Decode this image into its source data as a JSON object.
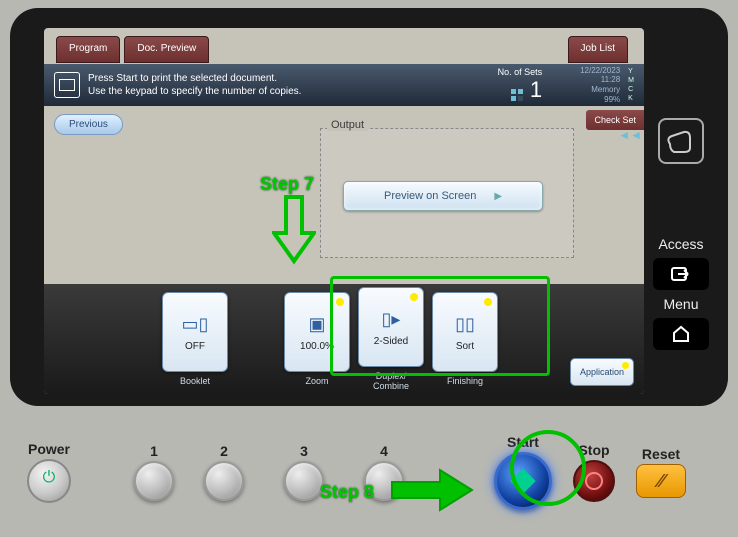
{
  "topnav": {
    "program": "Program",
    "doc_preview": "Doc. Preview",
    "job_list": "Job List"
  },
  "header": {
    "line1": "Press Start to print the selected document.",
    "line2": "Use the keypad to specify the number of copies.",
    "sets_label": "No. of Sets",
    "sets_value": "1"
  },
  "status": {
    "date": "12/22/2023",
    "time": "11:28",
    "memory_label": "Memory",
    "memory_value": "99%",
    "ind1": "Y",
    "ind2": "M",
    "ind3": "C",
    "ind4": "K"
  },
  "previous": "Previous",
  "check_settings": "Check Set",
  "output": {
    "title": "Output",
    "preview": "Preview on Screen"
  },
  "settings": {
    "booklet_val": "OFF",
    "booklet_label": "Booklet",
    "zoom_val": "100.0%",
    "zoom_label": "Zoom",
    "duplex_val": "2-Sided",
    "duplex_label": "Duplex/\nCombine",
    "finishing_val": "Sort",
    "finishing_label": "Finishing",
    "application": "Application"
  },
  "side": {
    "access": "Access",
    "menu": "Menu"
  },
  "hardware": {
    "power": "Power",
    "p1": "1",
    "p2": "2",
    "p3": "3",
    "p4": "4",
    "start": "Start",
    "stop": "Stop",
    "reset": "Reset",
    "reset_glyph": "⁄⁄"
  },
  "annotation": {
    "step7": "Step 7",
    "step8": "Step 8"
  }
}
